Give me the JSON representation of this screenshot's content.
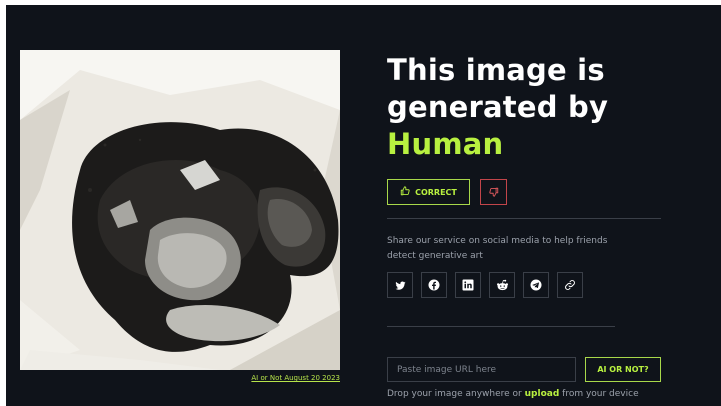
{
  "image": {
    "alt": "Burnt debris inside a white plastic bag",
    "caption": "AI or Not August 20 2023"
  },
  "result": {
    "line1": "This image is",
    "line2": "generated by",
    "verdict": "Human"
  },
  "feedback": {
    "correct_label": "CORRECT",
    "correct_icon": "thumbs-up-icon",
    "incorrect_icon": "thumbs-down-icon"
  },
  "share": {
    "text": "Share our service on social media to help friends detect generative art",
    "networks": [
      {
        "name": "twitter",
        "icon": "twitter-icon"
      },
      {
        "name": "facebook",
        "icon": "facebook-icon"
      },
      {
        "name": "linkedin",
        "icon": "linkedin-icon"
      },
      {
        "name": "reddit",
        "icon": "reddit-icon"
      },
      {
        "name": "telegram",
        "icon": "telegram-icon"
      },
      {
        "name": "copy-link",
        "icon": "link-icon"
      }
    ]
  },
  "check": {
    "url_value": "",
    "url_placeholder": "Paste image URL here",
    "button_label": "AI OR NOT?"
  },
  "drop": {
    "prefix": "Drop your image anywhere or",
    "link": "upload",
    "suffix": "from your device"
  },
  "colors": {
    "background": "#0f131a",
    "accent": "#b8f040",
    "danger": "#c2454a",
    "muted_text": "#9ba1ab"
  }
}
